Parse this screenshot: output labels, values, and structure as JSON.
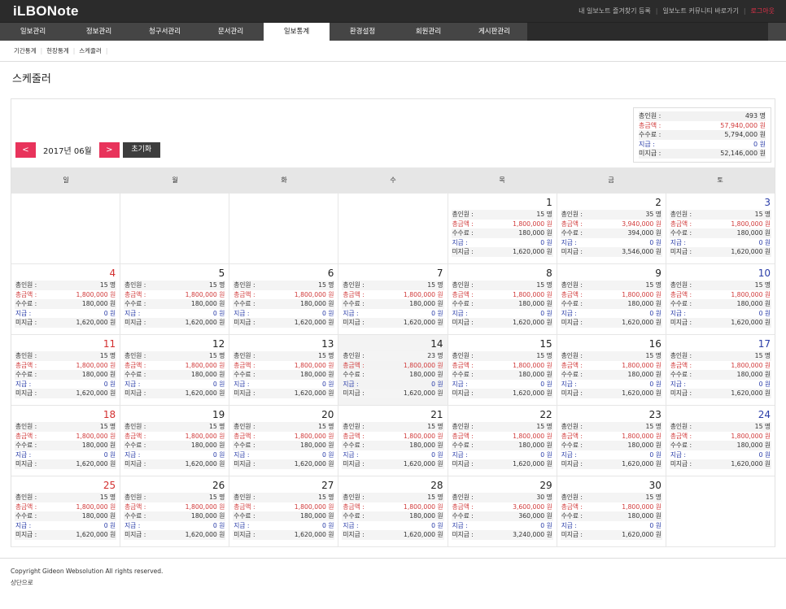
{
  "app": {
    "logo": "iLBONote"
  },
  "toplinks": {
    "bookmark": "내 일보노트 즐겨찾기 등록",
    "community": "일보노트 커뮤니티 바로가기",
    "logout": "로그아웃"
  },
  "nav": [
    "일보관리",
    "정보관리",
    "청구서관리",
    "문서관리",
    "일보통계",
    "환경설정",
    "회원관리",
    "게시판관리"
  ],
  "subnav": [
    "기간통계",
    "현장통계",
    "스케쥴러"
  ],
  "page_title": "스케줄러",
  "summary": {
    "labels": [
      "총인원 :",
      "총금액 :",
      "수수료 :",
      "지급 :",
      "미지급 :"
    ],
    "values": [
      "493 명",
      "57,940,000 원",
      "5,794,000 원",
      "0 원",
      "52,146,000 원"
    ]
  },
  "month": {
    "prev": "<",
    "label": "2017년 06월",
    "next": ">",
    "reset": "초기화"
  },
  "weekdays": [
    "일",
    "월",
    "화",
    "수",
    "목",
    "금",
    "토"
  ],
  "labels": [
    "총인원 :",
    "총금액 :",
    "수수료 :",
    "지급 :",
    "미지급 :"
  ],
  "weeks": [
    [
      null,
      null,
      null,
      null,
      {
        "day": "1",
        "values": [
          "15 명",
          "1,800,000 원",
          "180,000 원",
          "0 원",
          "1,620,000 원"
        ]
      },
      {
        "day": "2",
        "values": [
          "35 명",
          "3,940,000 원",
          "394,000 원",
          "0 원",
          "3,546,000 원"
        ]
      },
      {
        "day": "3",
        "values": [
          "15 명",
          "1,800,000 원",
          "180,000 원",
          "0 원",
          "1,620,000 원"
        ]
      }
    ],
    [
      {
        "day": "4",
        "values": [
          "15 명",
          "1,800,000 원",
          "180,000 원",
          "0 원",
          "1,620,000 원"
        ]
      },
      {
        "day": "5",
        "values": [
          "15 명",
          "1,800,000 원",
          "180,000 원",
          "0 원",
          "1,620,000 원"
        ]
      },
      {
        "day": "6",
        "values": [
          "15 명",
          "1,800,000 원",
          "180,000 원",
          "0 원",
          "1,620,000 원"
        ]
      },
      {
        "day": "7",
        "values": [
          "15 명",
          "1,800,000 원",
          "180,000 원",
          "0 원",
          "1,620,000 원"
        ]
      },
      {
        "day": "8",
        "values": [
          "15 명",
          "1,800,000 원",
          "180,000 원",
          "0 원",
          "1,620,000 원"
        ]
      },
      {
        "day": "9",
        "values": [
          "15 명",
          "1,800,000 원",
          "180,000 원",
          "0 원",
          "1,620,000 원"
        ]
      },
      {
        "day": "10",
        "values": [
          "15 명",
          "1,800,000 원",
          "180,000 원",
          "0 원",
          "1,620,000 원"
        ]
      }
    ],
    [
      {
        "day": "11",
        "values": [
          "15 명",
          "1,800,000 원",
          "180,000 원",
          "0 원",
          "1,620,000 원"
        ]
      },
      {
        "day": "12",
        "values": [
          "15 명",
          "1,800,000 원",
          "180,000 원",
          "0 원",
          "1,620,000 원"
        ]
      },
      {
        "day": "13",
        "values": [
          "15 명",
          "1,800,000 원",
          "180,000 원",
          "0 원",
          "1,620,000 원"
        ]
      },
      {
        "day": "14",
        "values": [
          "23 명",
          "1,800,000 원",
          "180,000 원",
          "0 원",
          "1,620,000 원"
        ]
      },
      {
        "day": "15",
        "values": [
          "15 명",
          "1,800,000 원",
          "180,000 원",
          "0 원",
          "1,620,000 원"
        ]
      },
      {
        "day": "16",
        "values": [
          "15 명",
          "1,800,000 원",
          "180,000 원",
          "0 원",
          "1,620,000 원"
        ]
      },
      {
        "day": "17",
        "values": [
          "15 명",
          "1,800,000 원",
          "180,000 원",
          "0 원",
          "1,620,000 원"
        ]
      }
    ],
    [
      {
        "day": "18",
        "values": [
          "15 명",
          "1,800,000 원",
          "180,000 원",
          "0 원",
          "1,620,000 원"
        ]
      },
      {
        "day": "19",
        "values": [
          "15 명",
          "1,800,000 원",
          "180,000 원",
          "0 원",
          "1,620,000 원"
        ]
      },
      {
        "day": "20",
        "values": [
          "15 명",
          "1,800,000 원",
          "180,000 원",
          "0 원",
          "1,620,000 원"
        ]
      },
      {
        "day": "21",
        "values": [
          "15 명",
          "1,800,000 원",
          "180,000 원",
          "0 원",
          "1,620,000 원"
        ]
      },
      {
        "day": "22",
        "values": [
          "15 명",
          "1,800,000 원",
          "180,000 원",
          "0 원",
          "1,620,000 원"
        ]
      },
      {
        "day": "23",
        "values": [
          "15 명",
          "1,800,000 원",
          "180,000 원",
          "0 원",
          "1,620,000 원"
        ]
      },
      {
        "day": "24",
        "values": [
          "15 명",
          "1,800,000 원",
          "180,000 원",
          "0 원",
          "1,620,000 원"
        ]
      }
    ],
    [
      {
        "day": "25",
        "values": [
          "15 명",
          "1,800,000 원",
          "180,000 원",
          "0 원",
          "1,620,000 원"
        ]
      },
      {
        "day": "26",
        "values": [
          "15 명",
          "1,800,000 원",
          "180,000 원",
          "0 원",
          "1,620,000 원"
        ]
      },
      {
        "day": "27",
        "values": [
          "15 명",
          "1,800,000 원",
          "180,000 원",
          "0 원",
          "1,620,000 원"
        ]
      },
      {
        "day": "28",
        "values": [
          "15 명",
          "1,800,000 원",
          "180,000 원",
          "0 원",
          "1,620,000 원"
        ]
      },
      {
        "day": "29",
        "values": [
          "30 명",
          "3,600,000 원",
          "360,000 원",
          "0 원",
          "3,240,000 원"
        ]
      },
      {
        "day": "30",
        "values": [
          "15 명",
          "1,800,000 원",
          "180,000 원",
          "0 원",
          "1,620,000 원"
        ]
      },
      null
    ]
  ],
  "colors": {
    "accent": "#e8335b",
    "money": "#d13a3a",
    "paid": "#2a3da8",
    "saturday": "#2a3da8",
    "sunday": "#d32f2f",
    "header_bg": "#2b2b2b",
    "nav_bg": "#454545"
  },
  "footer": {
    "copyright": "Copyright Gideon Websolution All rights reserved.",
    "top": "상단으로"
  }
}
